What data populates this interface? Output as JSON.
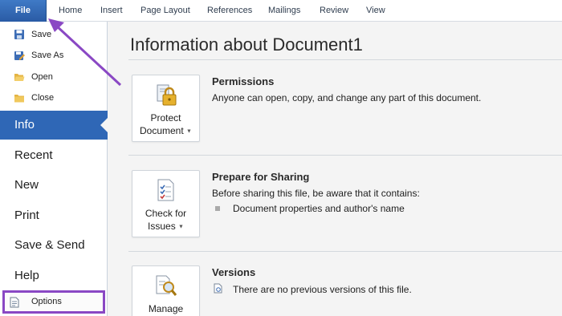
{
  "ribbon": {
    "tabs": [
      "File",
      "Home",
      "Insert",
      "Page Layout",
      "References",
      "Mailings",
      "Review",
      "View"
    ]
  },
  "backstage": {
    "commands": [
      {
        "label": "Save",
        "icon": "save-icon"
      },
      {
        "label": "Save As",
        "icon": "save-as-icon"
      },
      {
        "label": "Open",
        "icon": "open-folder-icon"
      },
      {
        "label": "Close",
        "icon": "close-folder-icon"
      }
    ],
    "nav": [
      "Info",
      "Recent",
      "New",
      "Print",
      "Save & Send",
      "Help"
    ],
    "selected": "Info",
    "options_label": "Options"
  },
  "main": {
    "title": "Information about Document1",
    "sections": [
      {
        "button_line1": "Protect",
        "button_line2": "Document",
        "icon": "lock-icon",
        "heading": "Permissions",
        "text": "Anyone can open, copy, and change any part of this document."
      },
      {
        "button_line1": "Check for",
        "button_line2": "Issues",
        "icon": "checklist-icon",
        "heading": "Prepare for Sharing",
        "text": "Before sharing this file, be aware that it contains:",
        "bullets": [
          "Document properties and author's name"
        ]
      },
      {
        "button_line1": "Manage",
        "icon": "magnifier-document-icon",
        "heading": "Versions",
        "text": "There are no previous versions of this file."
      }
    ]
  },
  "colors": {
    "file_tab": "#2a5ba5",
    "selected_nav": "#2f67b6",
    "annotation": "#8a48c4"
  }
}
